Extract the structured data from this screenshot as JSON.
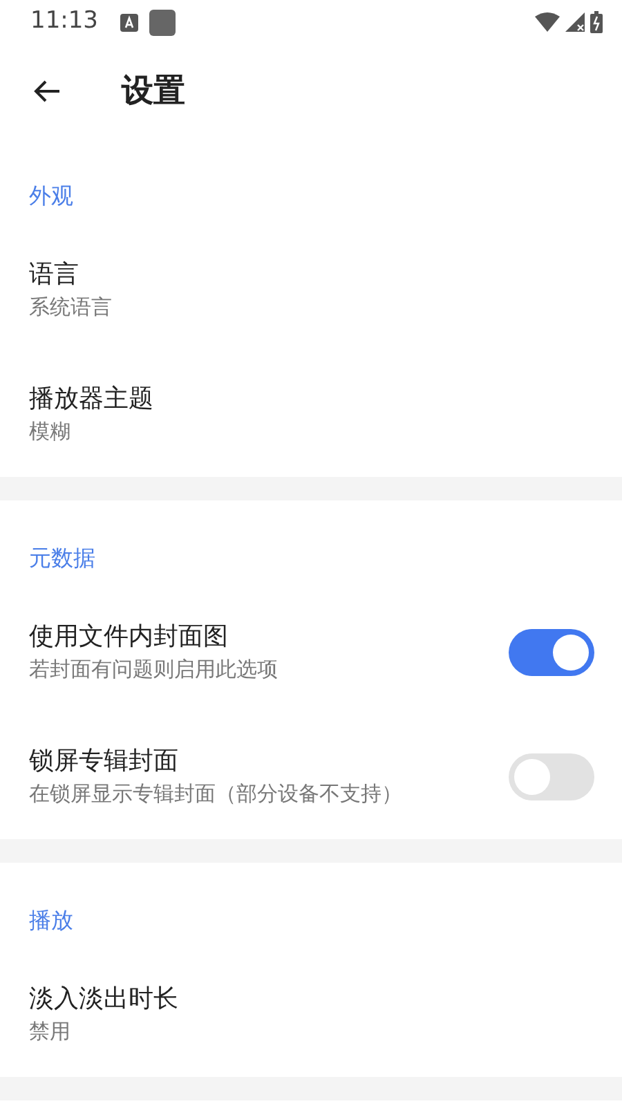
{
  "status_bar": {
    "time": "11:13"
  },
  "app_bar": {
    "title": "设置"
  },
  "sections": [
    {
      "header": "外观",
      "items": [
        {
          "kind": "value",
          "title": "语言",
          "subtitle": "系统语言"
        },
        {
          "kind": "value",
          "title": "播放器主题",
          "subtitle": "模糊"
        }
      ]
    },
    {
      "header": "元数据",
      "items": [
        {
          "kind": "switch",
          "title": "使用文件内封面图",
          "subtitle": "若封面有问题则启用此选项",
          "on": true
        },
        {
          "kind": "switch",
          "title": "锁屏专辑封面",
          "subtitle": "在锁屏显示专辑封面（部分设备不支持）",
          "on": false
        }
      ]
    },
    {
      "header": "播放",
      "items": [
        {
          "kind": "value",
          "title": "淡入淡出时长",
          "subtitle": "禁用"
        }
      ]
    }
  ]
}
